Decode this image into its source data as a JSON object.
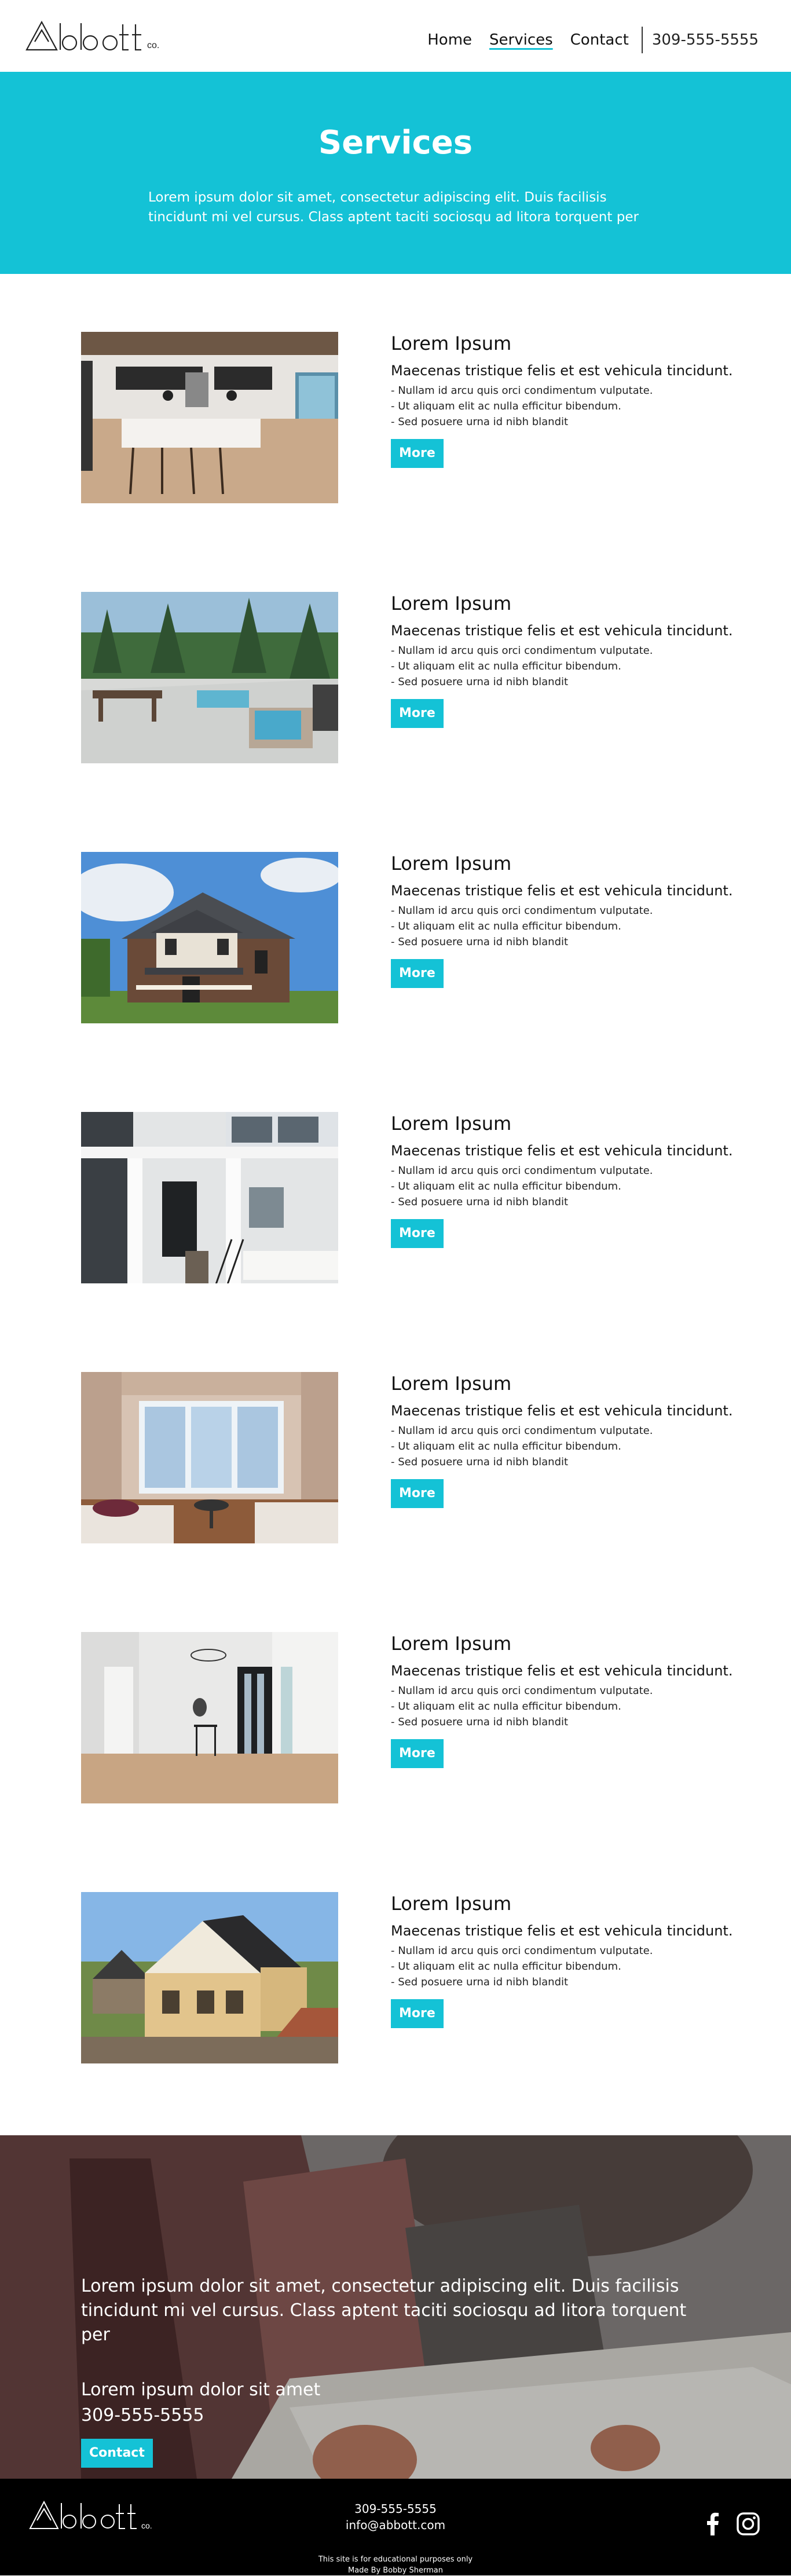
{
  "header": {
    "logo_text": "Abbott co.",
    "nav": [
      {
        "label": "Home",
        "active": false
      },
      {
        "label": "Services",
        "active": true
      },
      {
        "label": "Contact",
        "active": false
      }
    ],
    "phone": "309-555-5555"
  },
  "hero": {
    "title": "Services",
    "text": "Lorem ipsum dolor sit amet, consectetur adipiscing elit. Duis facilisis tincidunt mi vel cursus. Class aptent taciti sociosqu ad litora torquent per"
  },
  "services": [
    {
      "title": "Lorem Ipsum",
      "subtitle": "Maecenas tristique felis et est vehicula tincidunt.",
      "bullets": [
        "- Nullam id arcu quis orci condimentum vulputate.",
        "- Ut aliquam elit ac nulla efficitur bibendum.",
        "- Sed posuere urna id nibh blandit"
      ],
      "button": "More",
      "image": "kitchen-photo"
    },
    {
      "title": "Lorem Ipsum",
      "subtitle": "Maecenas tristique felis et est vehicula tincidunt.",
      "bullets": [
        "- Nullam id arcu quis orci condimentum vulputate.",
        "- Ut aliquam elit ac nulla efficitur bibendum.",
        "- Sed posuere urna id nibh blandit"
      ],
      "button": "More",
      "image": "deck-photo"
    },
    {
      "title": "Lorem Ipsum",
      "subtitle": "Maecenas tristique felis et est vehicula tincidunt.",
      "bullets": [
        "- Nullam id arcu quis orci condimentum vulputate.",
        "- Ut aliquam elit ac nulla efficitur bibendum.",
        "- Sed posuere urna id nibh blandit"
      ],
      "button": "More",
      "image": "house-exterior-photo"
    },
    {
      "title": "Lorem Ipsum",
      "subtitle": "Maecenas tristique felis et est vehicula tincidunt.",
      "bullets": [
        "- Nullam id arcu quis orci condimentum vulputate.",
        "- Ut aliquam elit ac nulla efficitur bibendum.",
        "- Sed posuere urna id nibh blandit"
      ],
      "button": "More",
      "image": "porch-photo"
    },
    {
      "title": "Lorem Ipsum",
      "subtitle": "Maecenas tristique felis et est vehicula tincidunt.",
      "bullets": [
        "- Nullam id arcu quis orci condimentum vulputate.",
        "- Ut aliquam elit ac nulla efficitur bibendum.",
        "- Sed posuere urna id nibh blandit"
      ],
      "button": "More",
      "image": "living-room-photo"
    },
    {
      "title": "Lorem Ipsum",
      "subtitle": "Maecenas tristique felis et est vehicula tincidunt.",
      "bullets": [
        "- Nullam id arcu quis orci condimentum vulputate.",
        "- Ut aliquam elit ac nulla efficitur bibendum.",
        "- Sed posuere urna id nibh blandit"
      ],
      "button": "More",
      "image": "entryway-photo"
    },
    {
      "title": "Lorem Ipsum",
      "subtitle": "Maecenas tristique felis et est vehicula tincidunt.",
      "bullets": [
        "- Nullam id arcu quis orci condimentum vulputate.",
        "- Ut aliquam elit ac nulla efficitur bibendum.",
        "- Sed posuere urna id nibh blandit"
      ],
      "button": "More",
      "image": "construction-photo"
    }
  ],
  "cta": {
    "text": "Lorem ipsum dolor sit amet, consectetur adipiscing elit. Duis facilisis tincidunt mi vel cursus. Class aptent taciti sociosqu ad litora torquent per",
    "address": "Lorem ipsum dolor sit amet",
    "phone": "309-555-5555",
    "button": "Contact"
  },
  "footer": {
    "phone": "309-555-5555",
    "email": "info@abbott.com",
    "note": "This site is for educational purposes only",
    "credit": "Made By Bobby Sherman",
    "social": [
      "facebook-icon",
      "instagram-icon"
    ]
  },
  "colors": {
    "accent": "#14c2d6",
    "footer_bg": "#000000"
  }
}
